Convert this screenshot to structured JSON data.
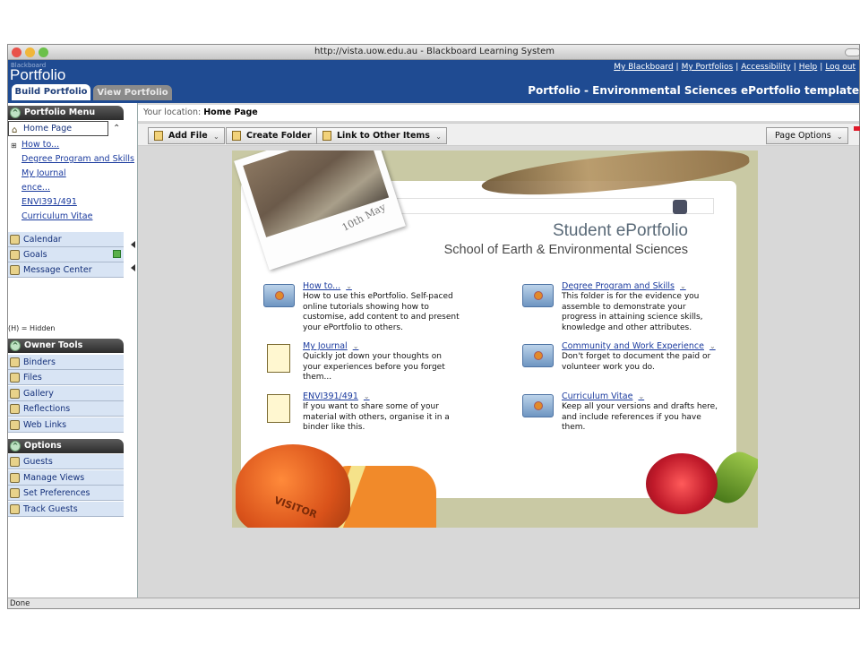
{
  "window": {
    "title": "http://vista.uow.edu.au - Blackboard Learning System"
  },
  "header": {
    "brand_small": "Blackboard",
    "brand": "Portfolio",
    "links": [
      "My Blackboard",
      "My Portfolios",
      "Accessibility",
      "Help",
      "Log out"
    ],
    "tabs": [
      {
        "label": "Build Portfolio",
        "active": true
      },
      {
        "label": "View Portfolio",
        "active": false
      }
    ],
    "page_title": "Portfolio - Environmental Sciences ePortfolio template"
  },
  "sidebar": {
    "portfolio_menu": {
      "heading": "Portfolio Menu",
      "selected": "Home Page",
      "items": [
        "How to...",
        "Degree Program and Skills",
        "My Journal",
        "ence...",
        "ENVI391/491",
        "Curriculum Vitae"
      ]
    },
    "quick": [
      {
        "label": "Calendar",
        "icon": "calendar-icon"
      },
      {
        "label": "Goals",
        "icon": "goals-icon"
      },
      {
        "label": "Message Center",
        "icon": "message-icon"
      }
    ],
    "hidden_note": "(H) = Hidden",
    "owner_tools": {
      "heading": "Owner Tools",
      "items": [
        {
          "label": "Binders",
          "icon": "binder-icon"
        },
        {
          "label": "Files",
          "icon": "files-icon"
        },
        {
          "label": "Gallery",
          "icon": "gallery-icon"
        },
        {
          "label": "Reflections",
          "icon": "reflections-icon"
        },
        {
          "label": "Web Links",
          "icon": "weblinks-icon"
        }
      ]
    },
    "options": {
      "heading": "Options",
      "items": [
        {
          "label": "Guests",
          "icon": "guests-icon"
        },
        {
          "label": "Manage Views",
          "icon": "views-icon"
        },
        {
          "label": "Set Preferences",
          "icon": "preferences-icon"
        },
        {
          "label": "Track Guests",
          "icon": "track-icon"
        }
      ]
    }
  },
  "main": {
    "location_label": "Your location:",
    "location": "Home Page",
    "toolbar": {
      "add_file": "Add File",
      "create_folder": "Create Folder",
      "link_items": "Link to Other Items",
      "page_options": "Page Options"
    },
    "photo_caption": "10th May",
    "hero_title": "Student ePortfolio",
    "hero_subtitle": "School of Earth & Environmental Sciences",
    "hat_text": "VISITOR",
    "entries_left": [
      {
        "title": "How to...",
        "desc": "How to use this ePortfolio. Self-paced online tutorials showing how to customise, add content to and present your ePortfolio to others."
      },
      {
        "title": "My Journal",
        "desc": "Quickly jot down your thoughts on your experiences before you forget them..."
      },
      {
        "title": "ENVI391/491",
        "desc": "If you want to share some of your material with others, organise it in a binder like this."
      }
    ],
    "entries_right": [
      {
        "title": "Degree Program and Skills",
        "desc": "This folder is for the evidence you assemble to demonstrate your progress in attaining science skills, knowledge and other attributes."
      },
      {
        "title": "Community and Work Experience",
        "desc": "Don't forget to document the paid or volunteer work you do."
      },
      {
        "title": "Curriculum Vitae",
        "desc": "Keep all your versions and drafts here, and include references if you have them."
      }
    ]
  },
  "status": "Done",
  "colors": {
    "header": "#1f4b92",
    "link": "#1a3a9e",
    "canvas": "#c9c9a4"
  }
}
